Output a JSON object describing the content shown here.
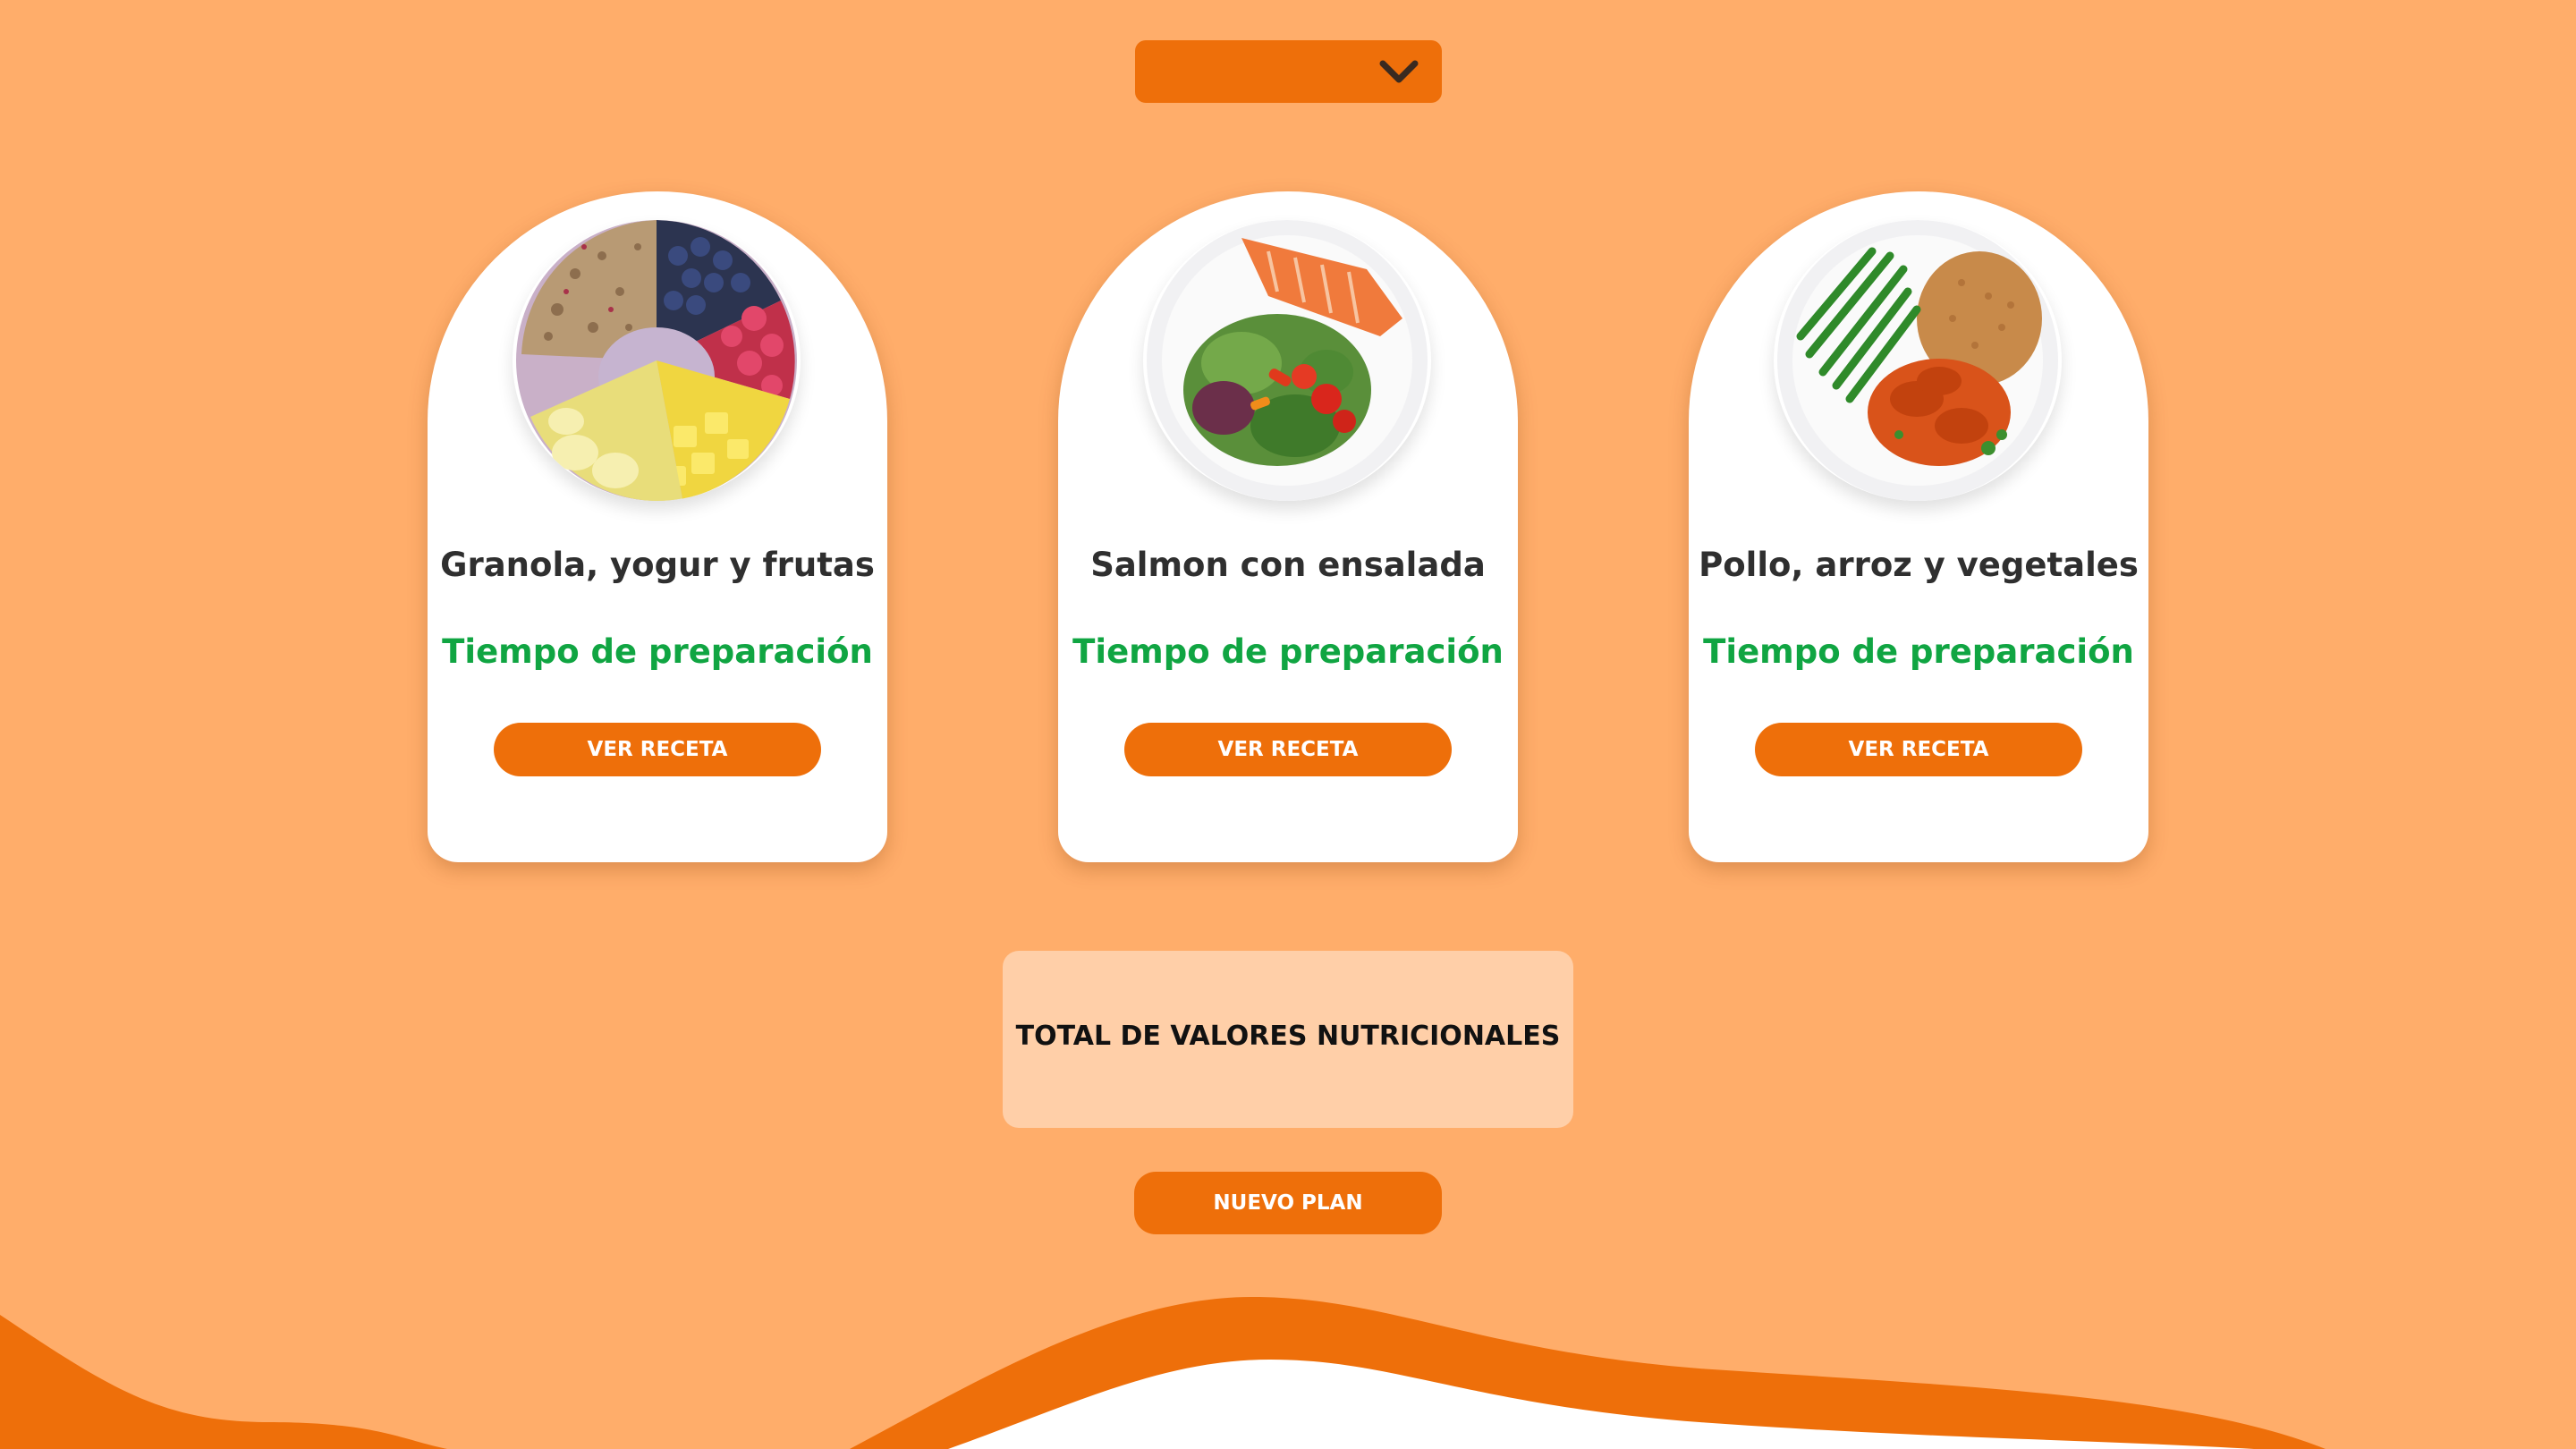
{
  "colors": {
    "background": "#FFAD6A",
    "accent": "#EE6F0A",
    "prep_time_green": "#10A542",
    "totals_panel": "#FFCFA8"
  },
  "dropdown": {
    "icon": "chevron-down-icon"
  },
  "cards": [
    {
      "image": "granola-yogurt-fruit-bowl-image",
      "name": "Granola, yogur y frutas",
      "prep_label": "Tiempo de preparación",
      "button_label": "VER RECETA"
    },
    {
      "image": "salmon-salad-plate-image",
      "name": "Salmon con ensalada",
      "prep_label": "Tiempo de preparación",
      "button_label": "VER RECETA"
    },
    {
      "image": "chicken-rice-vegetables-plate-image",
      "name": "Pollo, arroz y vegetales",
      "prep_label": "Tiempo de preparación",
      "button_label": "VER RECETA"
    }
  ],
  "totals": {
    "label": "TOTAL DE VALORES NUTRICIONALES"
  },
  "new_plan": {
    "label": "NUEVO PLAN"
  }
}
